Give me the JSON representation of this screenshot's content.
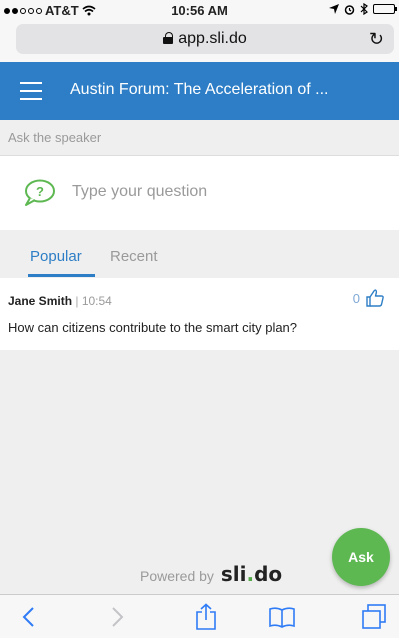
{
  "status_bar": {
    "carrier": "AT&T",
    "time": "10:56 AM"
  },
  "browser": {
    "url": "app.sli.do"
  },
  "header": {
    "title": "Austin Forum: The Acceleration of ..."
  },
  "ask": {
    "label": "Ask the speaker",
    "placeholder": "Type your question"
  },
  "tabs": [
    {
      "label": "Popular",
      "active": true
    },
    {
      "label": "Recent",
      "active": false
    }
  ],
  "questions": [
    {
      "author": "Jane Smith",
      "time": "10:54",
      "likes": "0",
      "text": "How can citizens contribute to the smart city plan?"
    }
  ],
  "footer": {
    "powered_by": "Powered by",
    "brand_prefix": "sli",
    "brand_dot": ".",
    "brand_suffix": "do"
  },
  "ask_button": {
    "label": "Ask"
  },
  "colors": {
    "header_blue": "#2d7ec6",
    "ask_green": "#5db852"
  },
  "icons": [
    "lock-icon",
    "reload-icon",
    "hamburger-icon",
    "question-bubble-icon",
    "thumbs-up-icon",
    "back-icon",
    "forward-icon",
    "share-icon",
    "bookmarks-icon",
    "tabs-icon"
  ]
}
